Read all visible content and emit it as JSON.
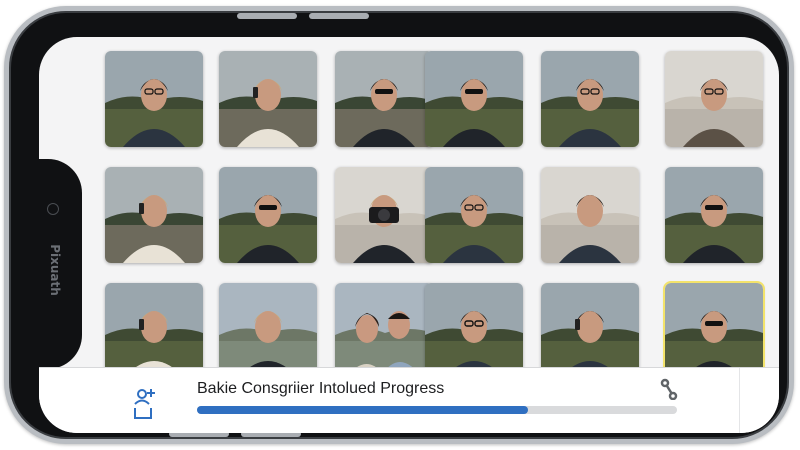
{
  "app": {
    "device_brand": "Pixuath"
  },
  "upload": {
    "title": "Bakie Consgriier Intolued Progress",
    "progress": 0.69,
    "accent_color": "#2f6fc1"
  },
  "icons": [
    "camera-icon",
    "add-user-icon",
    "link-icon"
  ],
  "photos": [
    {
      "scene": "man-field"
    },
    {
      "scene": "woman-phone-bridge"
    },
    {
      "scene": "woman-sunglasses-bridge"
    },
    {
      "scene": "woman-sunglasses-field"
    },
    {
      "scene": "man-field"
    },
    {
      "scene": "man-indoor"
    },
    {
      "scene": "woman-phone-bridge"
    },
    {
      "scene": "woman-sunglasses-field"
    },
    {
      "scene": "woman-camera"
    },
    {
      "scene": "man-field"
    },
    {
      "scene": "man-smiling"
    },
    {
      "scene": "woman-sunglasses-field"
    },
    {
      "scene": "woman-phone-field"
    },
    {
      "scene": "woman-portrait"
    },
    {
      "scene": "couple"
    },
    {
      "scene": "man-glasses"
    },
    {
      "scene": "man-phone-field"
    },
    {
      "scene": "woman-sunglasses-field",
      "selected": true
    }
  ]
}
